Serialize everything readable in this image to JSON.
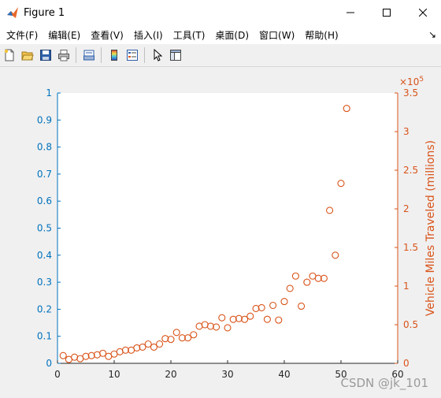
{
  "window": {
    "title": "Figure 1"
  },
  "menu": [
    "文件(F)",
    "编辑(E)",
    "查看(V)",
    "插入(I)",
    "工具(T)",
    "桌面(D)",
    "窗口(W)",
    "帮助(H)"
  ],
  "menu_overflow": "↘",
  "toolbar": {
    "icons": [
      "new-file-icon",
      "open-folder-icon",
      "save-icon",
      "print-icon",
      "print-preview-icon",
      "colorbar-icon",
      "legend-icon",
      "pointer-icon",
      "property-editor-icon"
    ]
  },
  "watermark": "CSDN @jk_101",
  "chart_data": {
    "type": "scatter",
    "left_axis": {
      "ylim": [
        0,
        1
      ],
      "ticks": [
        "0",
        "0.1",
        "0.2",
        "0.3",
        "0.4",
        "0.5",
        "0.6",
        "0.7",
        "0.8",
        "0.9",
        "1"
      ],
      "color": "#0072bd"
    },
    "right_axis": {
      "ylim": [
        0,
        3.5
      ],
      "ticks": [
        "0",
        "0.5",
        "1",
        "1.5",
        "2",
        "2.5",
        "3",
        "3.5"
      ],
      "exponent": "×10",
      "exponent_power": "5",
      "ylabel": "Vehicle Miles Traveled (millions)",
      "color": "#d95319"
    },
    "x_axis": {
      "xlim": [
        0,
        60
      ],
      "ticks": [
        "0",
        "10",
        "20",
        "30",
        "40",
        "50",
        "60"
      ]
    },
    "series": [
      {
        "marker": "circle-open",
        "color": "#d95319",
        "axis": "right",
        "x": [
          1,
          2,
          3,
          4,
          5,
          6,
          7,
          8,
          9,
          10,
          11,
          12,
          13,
          14,
          15,
          16,
          17,
          18,
          19,
          20,
          21,
          22,
          23,
          24,
          25,
          26,
          27,
          28,
          29,
          30,
          31,
          32,
          33,
          34,
          35,
          36,
          37,
          38,
          39,
          40,
          41,
          42,
          43,
          44,
          45,
          46,
          47,
          48,
          49,
          50,
          51
        ],
        "y": [
          0.1,
          0.05,
          0.08,
          0.06,
          0.09,
          0.1,
          0.11,
          0.13,
          0.09,
          0.12,
          0.15,
          0.17,
          0.17,
          0.2,
          0.21,
          0.25,
          0.21,
          0.25,
          0.32,
          0.31,
          0.4,
          0.33,
          0.33,
          0.37,
          0.48,
          0.5,
          0.48,
          0.47,
          0.59,
          0.46,
          0.57,
          0.58,
          0.57,
          0.61,
          0.71,
          0.72,
          0.57,
          0.75,
          0.56,
          0.8,
          0.97,
          1.13,
          0.74,
          1.05,
          1.13,
          1.1,
          1.1,
          1.98,
          1.4,
          2.33,
          3.3
        ]
      }
    ]
  }
}
